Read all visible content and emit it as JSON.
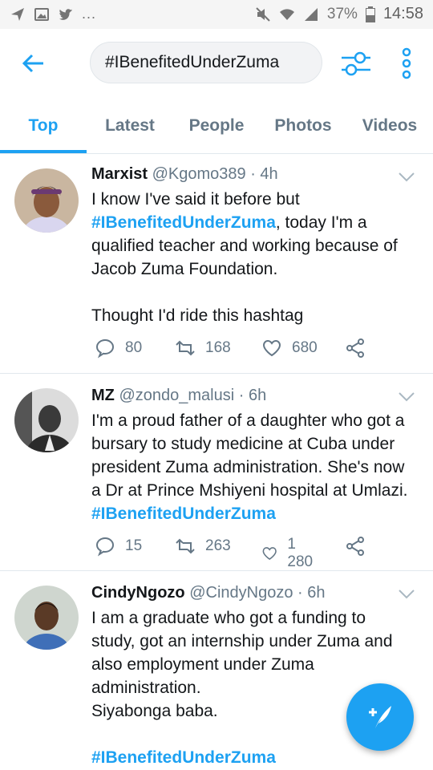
{
  "status_bar": {
    "battery": "37%",
    "time": "14:58",
    "icons": [
      "navigation-icon",
      "image-icon",
      "twitter-icon",
      "more-notifications-icon",
      "mute-icon",
      "wifi-icon",
      "signal-icon",
      "battery-icon"
    ]
  },
  "app_bar": {
    "search_query": "#IBenefitedUnderZuma",
    "back_icon": "back-arrow-icon",
    "filter_icon": "filter-icon",
    "more_icon": "more-vertical-icon"
  },
  "tabs": [
    {
      "label": "Top",
      "active": true
    },
    {
      "label": "Latest",
      "active": false
    },
    {
      "label": "People",
      "active": false
    },
    {
      "label": "Photos",
      "active": false
    },
    {
      "label": "Videos",
      "active": false
    }
  ],
  "tweets": [
    {
      "name": "Marxist",
      "handle": "@Kgomo389",
      "time": "· 4h",
      "lines": [
        "I know I've said it before but",
        "#IBenefitedUnderZuma",
        ", today I'm a",
        "qualified teacher and working because of",
        "Jacob Zuma Foundation.",
        "Thought I'd ride this hashtag"
      ],
      "replies": "80",
      "retweets": "168",
      "likes": "680"
    },
    {
      "name": "MZ",
      "handle": "@zondo_malusi",
      "time": "· 6h",
      "lines": [
        "I'm a proud father of a daughter who got a",
        "bursary to study medicine at Cuba under",
        "president Zuma administration. She's now",
        "a Dr at Prince Mshiyeni hospital at Umlazi.",
        "#IBenefitedUnderZuma"
      ],
      "replies": "15",
      "retweets": "263",
      "likes": "1 280"
    },
    {
      "name": "CindyNgozo",
      "handle": "@CindyNgozo",
      "time": "· 6h",
      "lines": [
        "I am a graduate who got a funding to",
        "study, got an internship under Zuma and",
        "also employment under Zuma",
        "administration.",
        "Siyabonga baba.",
        "#IBenefitedUnderZuma"
      ]
    }
  ],
  "colors": {
    "accent": "#1da1f2",
    "text": "#14171a",
    "muted": "#657786"
  },
  "fab_icon": "compose-tweet-icon"
}
